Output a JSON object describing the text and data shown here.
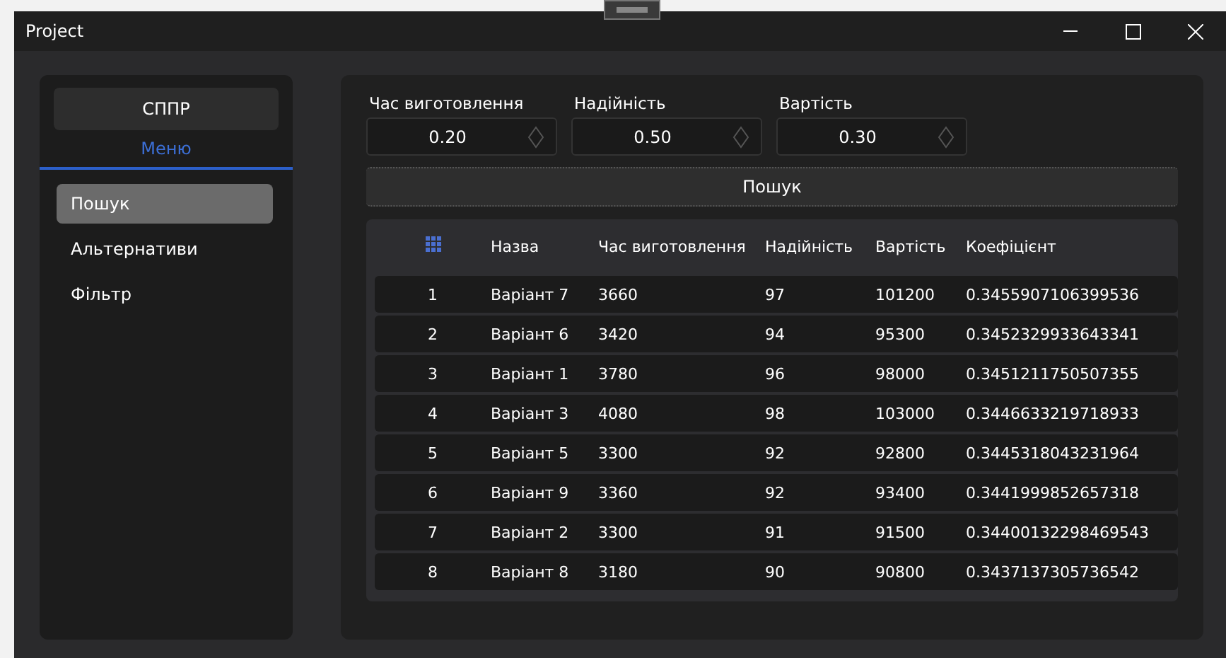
{
  "window": {
    "title": "Project"
  },
  "sidebar": {
    "title": "СППР",
    "section": "Меню",
    "items": [
      {
        "label": "Пошук",
        "selected": true
      },
      {
        "label": "Альтернативи",
        "selected": false
      },
      {
        "label": "Фільтр",
        "selected": false
      }
    ]
  },
  "weights": [
    {
      "label": "Час виготовлення",
      "value": "0.20"
    },
    {
      "label": "Надійність",
      "value": "0.50"
    },
    {
      "label": "Вартість",
      "value": "0.30"
    }
  ],
  "search_button": "Пошук",
  "table": {
    "columns": [
      {
        "kind": "icon"
      },
      {
        "kind": "text",
        "label": "Назва"
      },
      {
        "kind": "text",
        "label": "Час виготовлення"
      },
      {
        "kind": "text",
        "label": "Надійність"
      },
      {
        "kind": "text",
        "label": "Вартість"
      },
      {
        "kind": "text",
        "label": "Коефіцієнт"
      }
    ],
    "rows": [
      [
        "1",
        "Варіант 7",
        "3660",
        "97",
        "101200",
        "0.3455907106399536"
      ],
      [
        "2",
        "Варіант 6",
        "3420",
        "94",
        "95300",
        "0.3452329933643341"
      ],
      [
        "3",
        "Варіант 1",
        "3780",
        "96",
        "98000",
        "0.3451211750507355"
      ],
      [
        "4",
        "Варіант 3",
        "4080",
        "98",
        "103000",
        "0.3446633219718933"
      ],
      [
        "5",
        "Варіант 5",
        "3300",
        "92",
        "92800",
        "0.3445318043231964"
      ],
      [
        "6",
        "Варіант 9",
        "3360",
        "92",
        "93400",
        "0.3441999852657318"
      ],
      [
        "7",
        "Варіант 2",
        "3300",
        "91",
        "91500",
        "0.34400132298469543"
      ],
      [
        "8",
        "Варіант 8",
        "3180",
        "90",
        "90800",
        "0.3437137305736542"
      ]
    ]
  }
}
